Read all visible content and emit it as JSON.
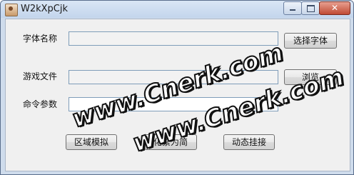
{
  "window": {
    "title": "W2kXpCjk"
  },
  "form": {
    "font_name_label": "字体名称",
    "game_file_label": "游戏文件",
    "command_args_label": "命令参数",
    "font_name_value": "",
    "game_file_value": "",
    "command_args_value": ""
  },
  "buttons": {
    "choose_font": "选择字体",
    "browse": "浏览",
    "region_sim": "区域模拟",
    "trad_to_simp": "化繁为简",
    "dynamic_hook": "动态挂接"
  },
  "watermark": {
    "text": "www.Cnerk.com"
  }
}
